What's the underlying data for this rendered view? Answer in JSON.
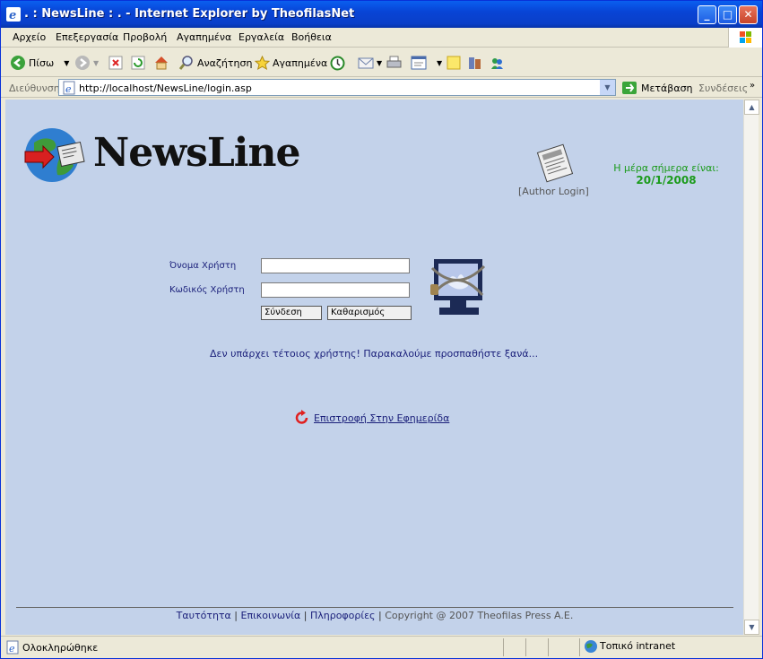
{
  "window": {
    "title": ". : NewsLine : . - Internet Explorer by TheofilasNet"
  },
  "menu": {
    "items": [
      "Αρχείο",
      "Επεξεργασία",
      "Προβολή",
      "Αγαπημένα",
      "Εργαλεία",
      "Βοήθεια"
    ]
  },
  "toolbar": {
    "back": "Πίσω",
    "search": "Αναζήτηση",
    "favorites": "Αγαπημένα"
  },
  "address": {
    "label": "Διεύθυνση",
    "url": "http://localhost/NewsLine/login.asp",
    "go": "Μετάβαση",
    "links": "Συνδέσεις"
  },
  "page": {
    "brand": "NewsLine",
    "author_login": "[Author Login]",
    "date_label": "Η μέρα σήμερα είναι:",
    "date_value": "20/1/2008",
    "username_label": "Όνομα Χρήστη",
    "password_label": "Κωδικός Χρήστη",
    "username_value": "",
    "password_value": "",
    "login_button": "Σύνδεση",
    "reset_button": "Καθαρισμός",
    "error_message": "Δεν υπάρχει τέτοιος χρήστης! Παρακαλούμε προσπαθήστε ξανά...",
    "back_link": "Επιστροφή Στην Εφημερίδα",
    "footer": {
      "identity": "Ταυτότητα",
      "contact": "Επικοινωνία",
      "info": "Πληροφορίες",
      "copyright": "Copyright @ 2007 Theofilas Press A.E.",
      "separator": "|"
    }
  },
  "status": {
    "text": "Ολοκληρώθηκε",
    "zone": "Τοπικό intranet"
  },
  "colors": {
    "titlebar": "#0a5fef",
    "page_bg": "#c3d2ea",
    "date_green": "#1b9b1b",
    "link_blue": "#1a1f7a"
  }
}
